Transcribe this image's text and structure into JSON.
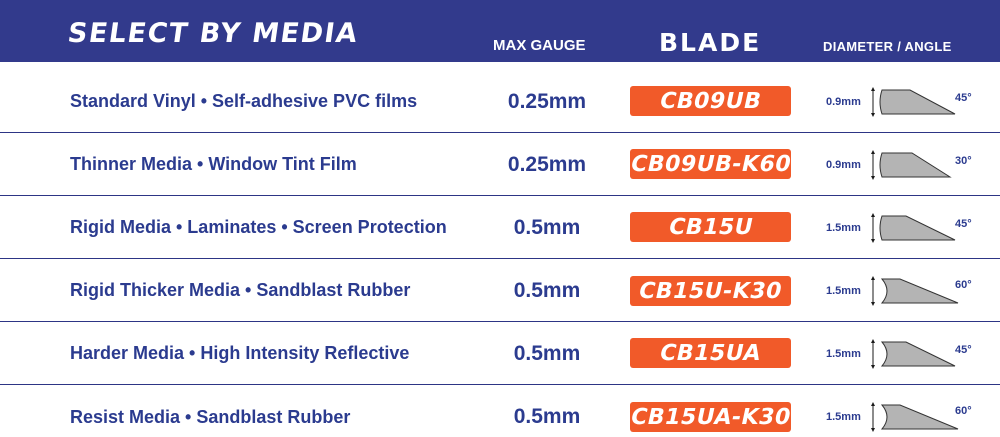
{
  "header": {
    "title": "SELECT BY MEDIA",
    "col_gauge": "MAX GAUGE",
    "col_blade": "BLADE",
    "col_diameter": "DIAMETER / ANGLE"
  },
  "colors": {
    "header_bg": "#323a8c",
    "text": "#2b3b8f",
    "blade_badge": "#f15a29",
    "blade_icon_fill": "#b4b4b4"
  },
  "rows": [
    {
      "media": "Standard Vinyl • Self-adhesive PVC films",
      "gauge": "0.25mm",
      "blade": "CB09UB",
      "diameter": "0.9mm",
      "angle": "45°",
      "icon": "blade-45-icon"
    },
    {
      "media": "Thinner Media • Window Tint Film",
      "gauge": "0.25mm",
      "blade": "CB09UB-K60",
      "diameter": "0.9mm",
      "angle": "30°",
      "icon": "blade-30-icon"
    },
    {
      "media": "Rigid  Media • Laminates • Screen Protection",
      "gauge": "0.5mm",
      "blade": "CB15U",
      "diameter": "1.5mm",
      "angle": "45°",
      "icon": "blade-45-icon"
    },
    {
      "media": "Rigid  Thicker Media • Sandblast Rubber",
      "gauge": "0.5mm",
      "blade": "CB15U-K30",
      "diameter": "1.5mm",
      "angle": "60°",
      "icon": "blade-60-icon"
    },
    {
      "media": "Harder Media • High Intensity Reflective",
      "gauge": "0.5mm",
      "blade": "CB15UA",
      "diameter": "1.5mm",
      "angle": "45°",
      "icon": "blade-45-icon"
    },
    {
      "media": "Resist Media • Sandblast Rubber",
      "gauge": "0.5mm",
      "blade": "CB15UA-K30",
      "diameter": "1.5mm",
      "angle": "60°",
      "icon": "blade-60-icon"
    }
  ]
}
